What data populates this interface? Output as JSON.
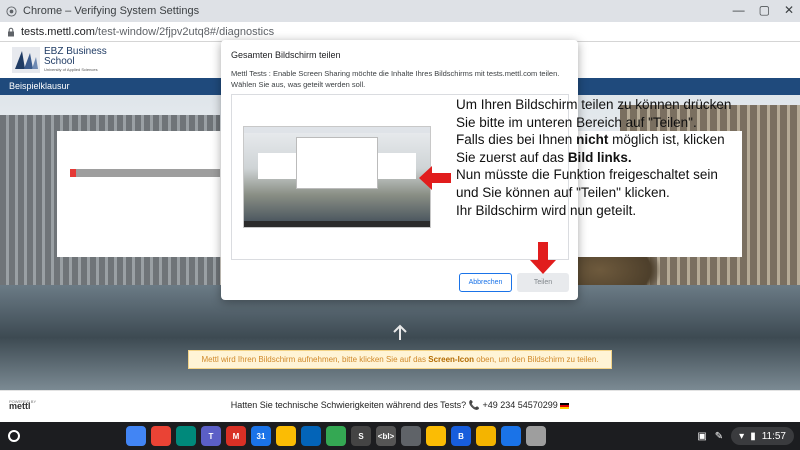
{
  "window": {
    "title": "Chrome – Verifying System Settings",
    "minimize_icon": "minimize-icon",
    "maximize_icon": "maximize-icon",
    "close_icon": "close-icon"
  },
  "address": {
    "host": "tests.mettl.com",
    "path": "/test-window/2fjpv2utq8#/diagnostics"
  },
  "site": {
    "brand_line1": "EBZ Business",
    "brand_line2": "School",
    "brand_sub": "University of Applied Sciences",
    "nav_label": "Beispielklausur"
  },
  "progress": {
    "fraction": 0.04,
    "color": "#e53935"
  },
  "dialog": {
    "title": "Gesamten Bildschirm teilen",
    "description": "Mettl Tests : Enable Screen Sharing möchte die Inhalte Ihres Bildschirms mit tests.mettl.com teilen. Wählen Sie aus, was geteilt werden soll.",
    "cancel_label": "Abbrechen",
    "share_label": "Teilen"
  },
  "instructions": {
    "l1": "Um Ihren Bildschirm teilen zu können drücken",
    "l2": "Sie bitte im unteren Bereich auf \"Teilen\".",
    "l3a": "Falls dies bei Ihnen ",
    "l3b": "nicht",
    "l3c": " möglich ist, klicken",
    "l4a": "Sie zuerst auf das ",
    "l4b": "Bild links.",
    "l5": "Nun müsste die Funktion freigeschaltet sein",
    "l6": "und Sie können auf \"Teilen\" klicken.",
    "l7": "Ihr Bildschirm wird nun geteilt."
  },
  "banner": {
    "pre": "Mettl wird Ihren Bildschirm aufnehmen, bitte klicken Sie auf das ",
    "bold": "Screen-Icon",
    "post": " oben, um den Bildschirm zu teilen."
  },
  "footer": {
    "powered_by": "POWERED BY",
    "brand": "mettl",
    "help": "Hatten Sie technische Schwierigkeiten während des Tests?",
    "phone": "+49 234 54570299"
  },
  "shelf": {
    "apps": [
      {
        "name": "files-icon",
        "color": "#4285f4",
        "text": ""
      },
      {
        "name": "chrome-icon",
        "color": "#ea4335",
        "text": ""
      },
      {
        "name": "meet-icon",
        "color": "#00897b",
        "text": ""
      },
      {
        "name": "teams-icon",
        "color": "#5b5fc7",
        "text": "T"
      },
      {
        "name": "gmail-icon",
        "color": "#d93025",
        "text": "M"
      },
      {
        "name": "calendar-icon",
        "color": "#1a73e8",
        "text": "31"
      },
      {
        "name": "drive-icon",
        "color": "#fbbc04",
        "text": ""
      },
      {
        "name": "onedrive-icon",
        "color": "#0364b8",
        "text": ""
      },
      {
        "name": "play-icon",
        "color": "#34a853",
        "text": ""
      },
      {
        "name": "s-app-icon",
        "color": "#444444",
        "text": "S"
      },
      {
        "name": "code-icon",
        "color": "#555555",
        "text": "<bl>"
      },
      {
        "name": "calculator-icon",
        "color": "#5f6368",
        "text": ""
      },
      {
        "name": "keep-icon",
        "color": "#fbbc04",
        "text": ""
      },
      {
        "name": "bitwarden-icon",
        "color": "#175ddc",
        "text": "B"
      },
      {
        "name": "slides-icon",
        "color": "#f4b400",
        "text": ""
      },
      {
        "name": "shield-icon",
        "color": "#1a73e8",
        "text": ""
      },
      {
        "name": "puzzle-icon",
        "color": "#9e9e9e",
        "text": ""
      }
    ],
    "time": "11:57"
  }
}
